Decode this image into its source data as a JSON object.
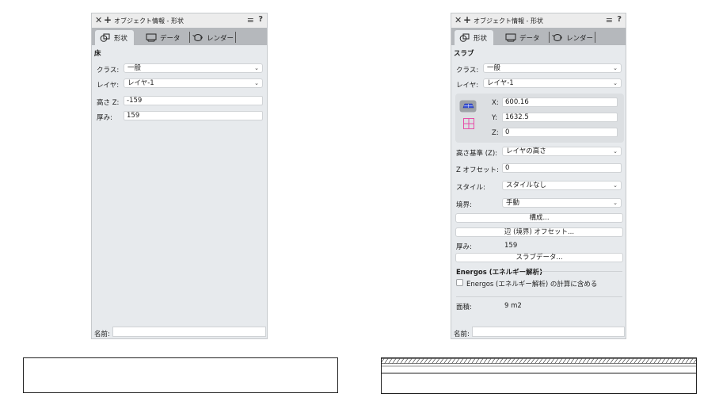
{
  "left_panel": {
    "title": "オブジェクト情報 - 形状",
    "tabs": [
      "形状",
      "データ",
      "レンダー"
    ],
    "section": "床",
    "class_label": "クラス:",
    "class_value": "一般",
    "layer_label": "レイヤ:",
    "layer_value": "レイヤ-1",
    "height_label": "高さ Z:",
    "height_value": "-159",
    "thickness_label": "厚み:",
    "thickness_value": "159",
    "name_label": "名前:",
    "name_value": ""
  },
  "right_panel": {
    "title": "オブジェクト情報 - 形状",
    "tabs": [
      "形状",
      "データ",
      "レンダー"
    ],
    "section": "スラブ",
    "class_label": "クラス:",
    "class_value": "一般",
    "layer_label": "レイヤ:",
    "layer_value": "レイヤ-1",
    "x_label": "X:",
    "x_value": "600.16",
    "y_label": "Y:",
    "y_value": "1632.5",
    "z_label": "Z:",
    "z_value": "0",
    "height_ref_label": "高さ基準 (Z):",
    "height_ref_value": "レイヤの高さ",
    "z_offset_label": "Z オフセット:",
    "z_offset_value": "0",
    "style_label": "スタイル:",
    "style_value": "スタイルなし",
    "boundary_label": "境界:",
    "boundary_value": "手動",
    "compose_button": "構成...",
    "edge_offset_button": "辺 (境界) オフセット...",
    "thickness_label": "厚み:",
    "thickness_value": "159",
    "slab_data_button": "スラブデータ...",
    "energos_title": "Energos (エネルギー解析)",
    "energos_checkbox_label": "Energos (エネルギー解析) の計算に含める",
    "area_label": "面積:",
    "area_value": "9 m2",
    "name_label": "名前:",
    "name_value": ""
  },
  "colors": {
    "panel_bg": "#e7eaed",
    "tabbar_bg": "#b5b8bc",
    "icon_blue": "#3b55d9",
    "icon_pink": "#e64ea8"
  }
}
